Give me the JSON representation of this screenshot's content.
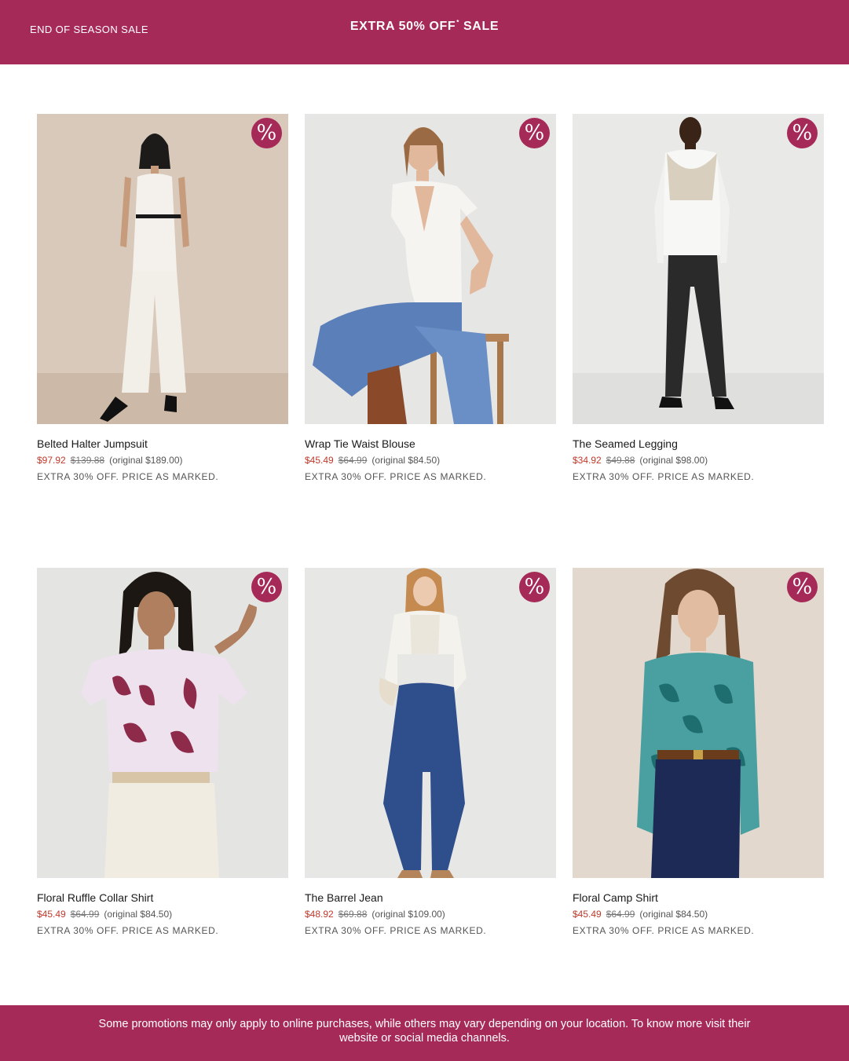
{
  "header": {
    "left_label": "END OF SEASON SALE",
    "center_label": "EXTRA 50% OFF",
    "center_mark": "*",
    "center_suffix": " SALE"
  },
  "badge_glyph": "%",
  "colors": {
    "brand": "#a62a57",
    "sale_price": "#c0392b"
  },
  "products": [
    {
      "name": "Belted Halter Jumpsuit",
      "sale_price": "$97.92",
      "was_price": "$139.88",
      "original": "(original $189.00)",
      "promo": "EXTRA 30% OFF. PRICE AS MARKED."
    },
    {
      "name": "Wrap Tie Waist Blouse",
      "sale_price": "$45.49",
      "was_price": "$64.99",
      "original": "(original $84.50)",
      "promo": "EXTRA 30% OFF. PRICE AS MARKED."
    },
    {
      "name": "The Seamed Legging",
      "sale_price": "$34.92",
      "was_price": "$49.88",
      "original": "(original $98.00)",
      "promo": "EXTRA 30% OFF. PRICE AS MARKED."
    },
    {
      "name": "Floral Ruffle Collar Shirt",
      "sale_price": "$45.49",
      "was_price": "$64.99",
      "original": "(original $84.50)",
      "promo": "EXTRA 30% OFF. PRICE AS MARKED."
    },
    {
      "name": "The Barrel Jean",
      "sale_price": "$48.92",
      "was_price": "$69.88",
      "original": "(original $109.00)",
      "promo": "EXTRA 30% OFF. PRICE AS MARKED."
    },
    {
      "name": "Floral Camp Shirt",
      "sale_price": "$45.49",
      "was_price": "$64.99",
      "original": "(original $84.50)",
      "promo": "EXTRA 30% OFF. PRICE AS MARKED."
    }
  ],
  "footer": {
    "note": "Some promotions may only apply to online purchases, while others may vary depending on your location. To know more visit their website or social media channels."
  }
}
